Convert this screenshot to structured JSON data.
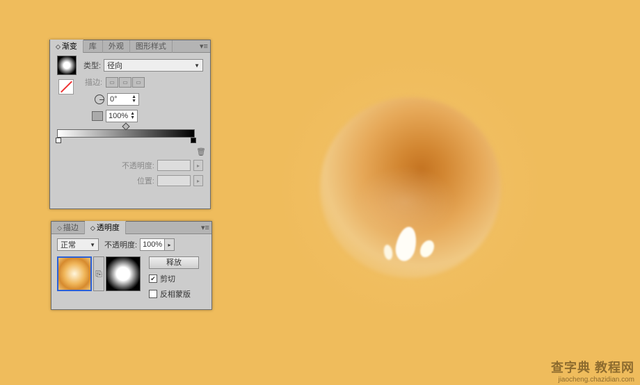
{
  "gradient_panel": {
    "tabs": {
      "gradient": "渐变",
      "library": "库",
      "appearance": "外观",
      "graphic_styles": "图形样式"
    },
    "type_label": "类型:",
    "type_value": "径向",
    "stroke_label": "描边:",
    "angle_value": "0°",
    "aspect_value": "100%",
    "opacity_label": "不透明度:",
    "location_label": "位置:"
  },
  "transparency_panel": {
    "tabs": {
      "stroke": "描边",
      "transparency": "透明度"
    },
    "blend_mode": "正常",
    "opacity_label": "不透明度:",
    "opacity_value": "100%",
    "release_btn": "释放",
    "clip_label": "剪切",
    "clip_checked": "✔",
    "invert_label": "反相蒙版"
  },
  "watermark": {
    "title": "查字典 教程网",
    "url": "jiaocheng.chazidian.com"
  }
}
